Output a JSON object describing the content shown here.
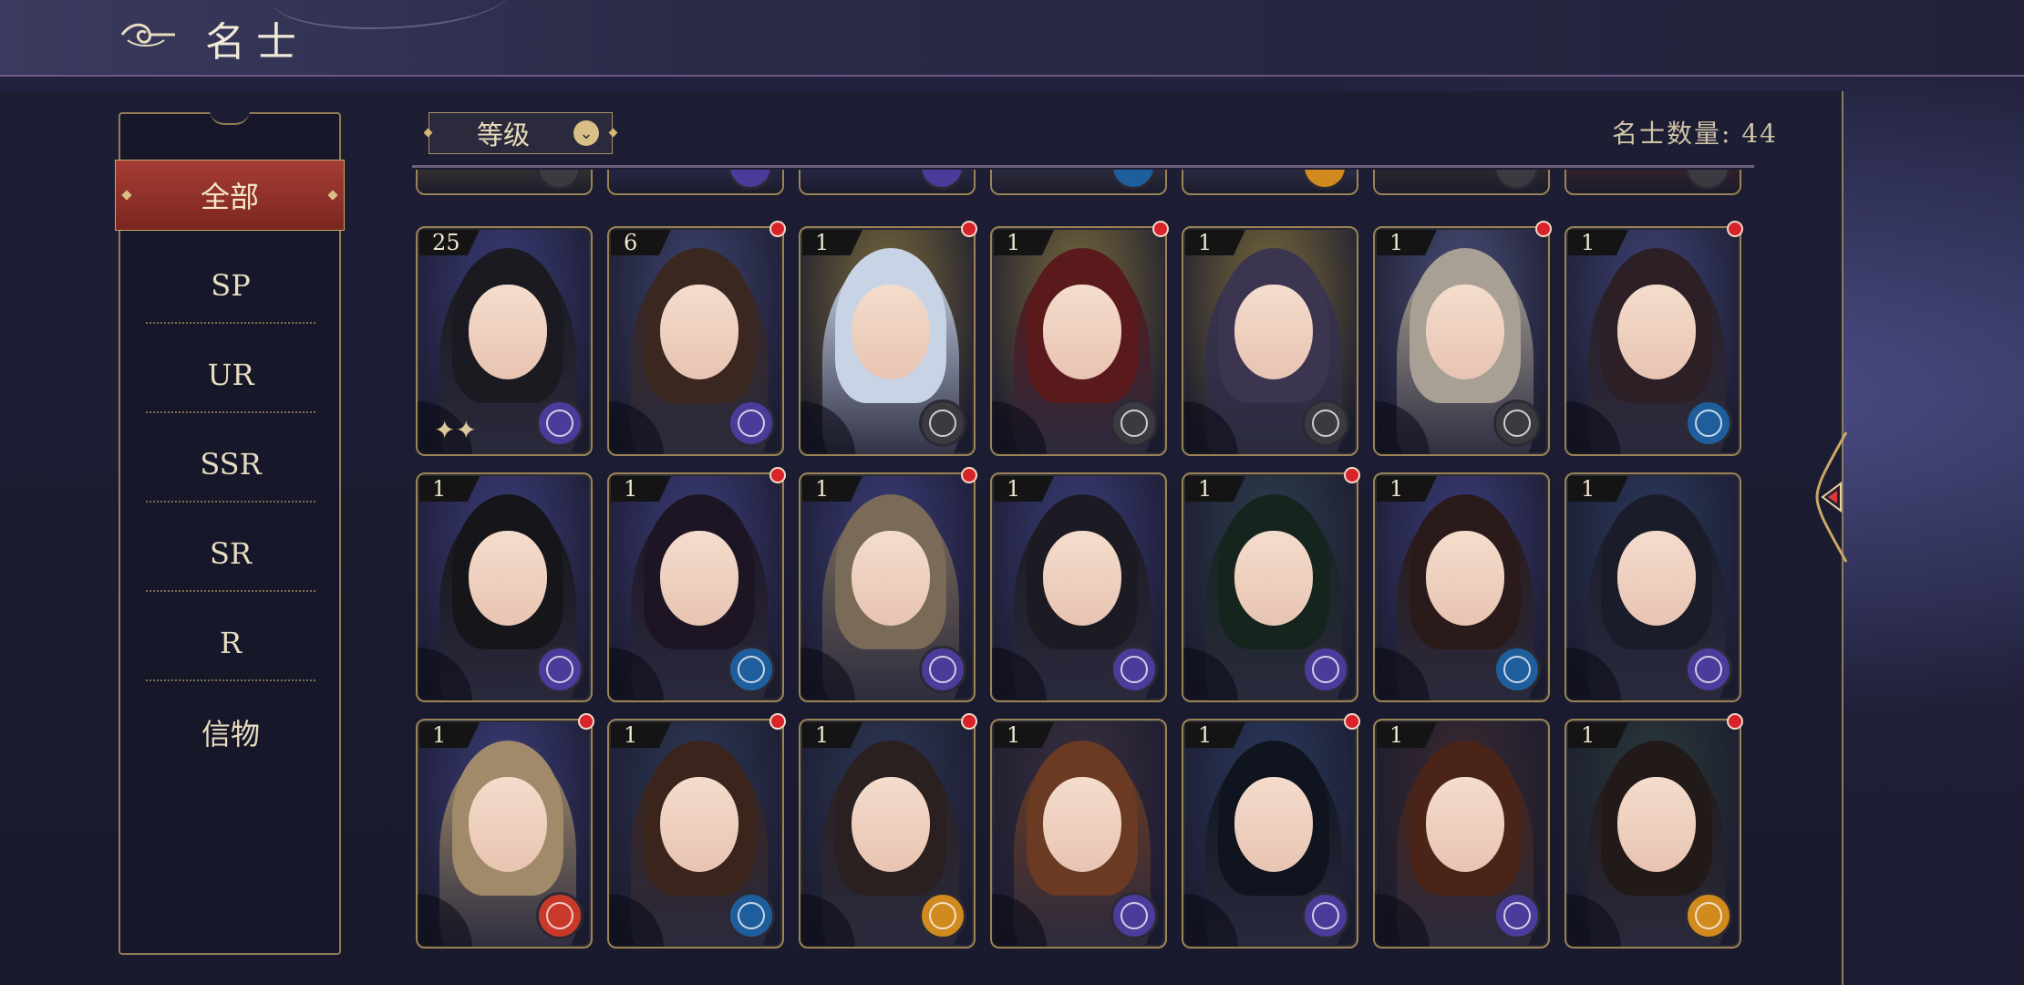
{
  "header": {
    "title": "名士"
  },
  "sidebar": {
    "items": [
      {
        "label": "全部",
        "active": true
      },
      {
        "label": "SP"
      },
      {
        "label": "UR"
      },
      {
        "label": "SSR"
      },
      {
        "label": "SR"
      },
      {
        "label": "R"
      },
      {
        "label": "信物"
      }
    ]
  },
  "toolbar": {
    "sort_label": "等级",
    "count_text": "名士数量: 44"
  },
  "colors": {
    "accent_gold": "#c9a865",
    "active_red": "#a53d35",
    "notify_red": "#d8232a"
  },
  "cards": [
    {
      "level": "25",
      "dot": false,
      "faction": "purple",
      "bg": "#3b3d7a",
      "hair": "#1a1a20",
      "sparkle": true
    },
    {
      "level": "6",
      "dot": true,
      "faction": "purple",
      "bg": "#3d4470",
      "hair": "#3a2720",
      "sparkle": false
    },
    {
      "level": "1",
      "dot": true,
      "faction": "gray",
      "bg": "#7a6a3c",
      "hair": "#c9d3e6",
      "sparkle": false
    },
    {
      "level": "1",
      "dot": true,
      "faction": "gray",
      "bg": "#7a6a3c",
      "hair": "#5a1a1c",
      "sparkle": false
    },
    {
      "level": "1",
      "dot": false,
      "faction": "gray",
      "bg": "#7a6a3c",
      "hair": "#3c3550",
      "sparkle": false
    },
    {
      "level": "1",
      "dot": true,
      "faction": "gray",
      "bg": "#4a4f78",
      "hair": "#a8a094",
      "sparkle": false
    },
    {
      "level": "1",
      "dot": true,
      "faction": "blue",
      "bg": "#3f4478",
      "hair": "#2c1f26",
      "sparkle": false
    },
    {
      "level": "1",
      "dot": false,
      "faction": "purple",
      "bg": "#3b3d7a",
      "hair": "#15151a",
      "sparkle": false
    },
    {
      "level": "1",
      "dot": true,
      "faction": "blue",
      "bg": "#3b3d7a",
      "hair": "#1d1524",
      "sparkle": false
    },
    {
      "level": "1",
      "dot": true,
      "faction": "purple",
      "bg": "#3b3d7a",
      "hair": "#7a6a58",
      "sparkle": false
    },
    {
      "level": "1",
      "dot": false,
      "faction": "purple",
      "bg": "#3b3d7a",
      "hair": "#1c1a22",
      "sparkle": false
    },
    {
      "level": "1",
      "dot": true,
      "faction": "purple",
      "bg": "#2e3e4e",
      "hair": "#16241e",
      "sparkle": false
    },
    {
      "level": "1",
      "dot": false,
      "faction": "blue",
      "bg": "#3b3d7a",
      "hair": "#2a1a1a",
      "sparkle": false
    },
    {
      "level": "1",
      "dot": false,
      "faction": "purple",
      "bg": "#2b3a5e",
      "hair": "#1a1c2a",
      "sparkle": false
    },
    {
      "level": "1",
      "dot": true,
      "faction": "red",
      "bg": "#3b3d7a",
      "hair": "#a08a6a",
      "sparkle": false
    },
    {
      "level": "1",
      "dot": true,
      "faction": "blue",
      "bg": "#2e3856",
      "hair": "#3a241c",
      "sparkle": false
    },
    {
      "level": "1",
      "dot": true,
      "faction": "orange",
      "bg": "#2e3856",
      "hair": "#2a2020",
      "sparkle": false
    },
    {
      "level": "1",
      "dot": false,
      "faction": "purple",
      "bg": "#3a3040",
      "hair": "#6a3a22",
      "sparkle": false
    },
    {
      "level": "1",
      "dot": true,
      "faction": "purple",
      "bg": "#2b3a5e",
      "hair": "#10141e",
      "sparkle": false
    },
    {
      "level": "1",
      "dot": false,
      "faction": "purple",
      "bg": "#3a2a30",
      "hair": "#4a2418",
      "sparkle": false
    },
    {
      "level": "1",
      "dot": true,
      "faction": "orange",
      "bg": "#2a3a3a",
      "hair": "#221a18",
      "sparkle": false
    }
  ],
  "partial_cards": [
    {
      "faction": "gray",
      "bg": "#6a5c3a"
    },
    {
      "faction": "purple",
      "bg": "#3b3d7a"
    },
    {
      "faction": "purple",
      "bg": "#3b3d7a"
    },
    {
      "faction": "blue",
      "bg": "#4a4a5a"
    },
    {
      "faction": "orange",
      "bg": "#4a4f78"
    },
    {
      "faction": "gray",
      "bg": "#4a3a30"
    },
    {
      "faction": "gray",
      "bg": "#5a2a2a"
    }
  ]
}
